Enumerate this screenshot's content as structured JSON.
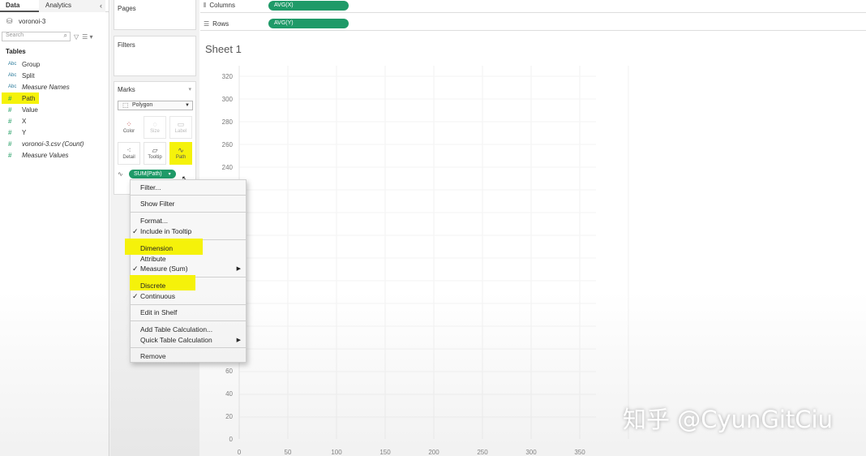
{
  "data_pane": {
    "tabs": [
      "Data",
      "Analytics"
    ],
    "collapse_icon": "chevron-left-icon",
    "datasource": "voronoi-3",
    "search_placeholder": "Search",
    "section_title": "Tables",
    "fields": [
      {
        "type": "Abc",
        "name": "Group"
      },
      {
        "type": "Abc",
        "name": "Split"
      },
      {
        "type": "Abc",
        "name": "Measure Names"
      },
      {
        "type": "#",
        "name": "Path"
      },
      {
        "type": "#",
        "name": "Value"
      },
      {
        "type": "#",
        "name": "X"
      },
      {
        "type": "#",
        "name": "Y"
      },
      {
        "type": "#",
        "name": "voronoi-3.csv (Count)"
      },
      {
        "type": "#",
        "name": "Measure Values"
      }
    ]
  },
  "cards": {
    "pages": "Pages",
    "filters": "Filters",
    "marks": "Marks",
    "mark_type": "Polygon",
    "buttons": {
      "color": "Color",
      "size": "Size",
      "label": "Label",
      "detail": "Detail",
      "tooltip": "Tooltip",
      "path": "Path"
    },
    "pill": "SUM(Path)"
  },
  "shelves": {
    "columns_label": "Columns",
    "columns_pill": "AVG(X)",
    "rows_label": "Rows",
    "rows_pill": "AVG(Y)"
  },
  "view": {
    "sheet_title": "Sheet 1",
    "y_ticks_top": [
      "320",
      "300",
      "280",
      "260",
      "240"
    ],
    "y_ticks_bottom": [
      "60",
      "40",
      "20",
      "0"
    ],
    "x_ticks": [
      "0",
      "50",
      "100",
      "150",
      "200",
      "250",
      "300",
      "350"
    ]
  },
  "context_menu": {
    "filter": "Filter...",
    "show_filter": "Show Filter",
    "format": "Format...",
    "include_tooltip": "Include in Tooltip",
    "dimension": "Dimension",
    "attribute": "Attribute",
    "measure": "Measure (Sum)",
    "discrete": "Discrete",
    "continuous": "Continuous",
    "edit_in_shelf": "Edit in Shelf",
    "add_table_calc": "Add Table Calculation...",
    "quick_table_calc": "Quick Table Calculation",
    "remove": "Remove"
  },
  "watermark": "知乎 @CyunGitCiu",
  "colors": {
    "pill_green": "#1f9a68",
    "highlight_yellow": "#f5f20a"
  }
}
